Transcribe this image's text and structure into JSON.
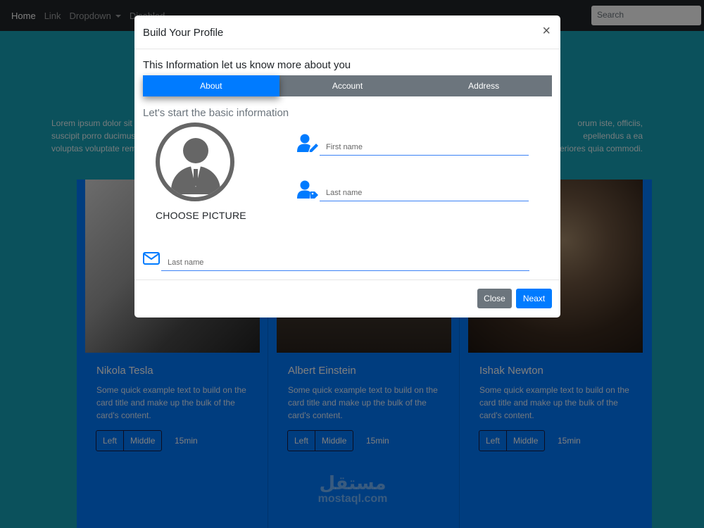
{
  "navbar": {
    "items": [
      "Home",
      "Link",
      "Dropdown",
      "Disabled"
    ],
    "search_placeholder": "Search"
  },
  "hero": {
    "text_left": "Lorem ipsum dolor sit",
    "text_left_2": "suscipit porro ducimus",
    "text_left_3": "voluptas voluptate rem",
    "text_right": "orum iste, officiis,",
    "text_right_2": "epellendus a ea",
    "text_right_3": "eriores quia commodi."
  },
  "cards": [
    {
      "title": "Nikola Tesla",
      "text": "Some quick example text to build on the card title and make up the bulk of the card's content.",
      "btn_left": "Left",
      "btn_middle": "Middle",
      "time": "15min"
    },
    {
      "title": "Albert Einstein",
      "text": "Some quick example text to build on the card title and make up the bulk of the card's content.",
      "btn_left": "Left",
      "btn_middle": "Middle",
      "time": "15min"
    },
    {
      "title": "Ishak Newton",
      "text": "Some quick example text to build on the card title and make up the bulk of the card's content.",
      "btn_left": "Left",
      "btn_middle": "Middle",
      "time": "15min"
    }
  ],
  "modal": {
    "title": "Build Your Profile",
    "close_symbol": "×",
    "info_title": "This Information let us know more about you",
    "tabs": [
      "About",
      "Account",
      "Address"
    ],
    "active_tab": "About",
    "subtitle": "Let's start the basic information",
    "choose_picture": "CHOOSE PICTURE",
    "first_name_placeholder": "First name",
    "last_name_placeholder": "Last name",
    "email_placeholder": "Last name",
    "close_label": "Close",
    "next_label": "Neaxt"
  },
  "watermark": {
    "arabic": "مستقل",
    "latin": "mostaql.com"
  },
  "colors": {
    "primary": "#007bff",
    "secondary": "#6c757d",
    "hero": "#17a2b8",
    "navbar": "#212529"
  }
}
